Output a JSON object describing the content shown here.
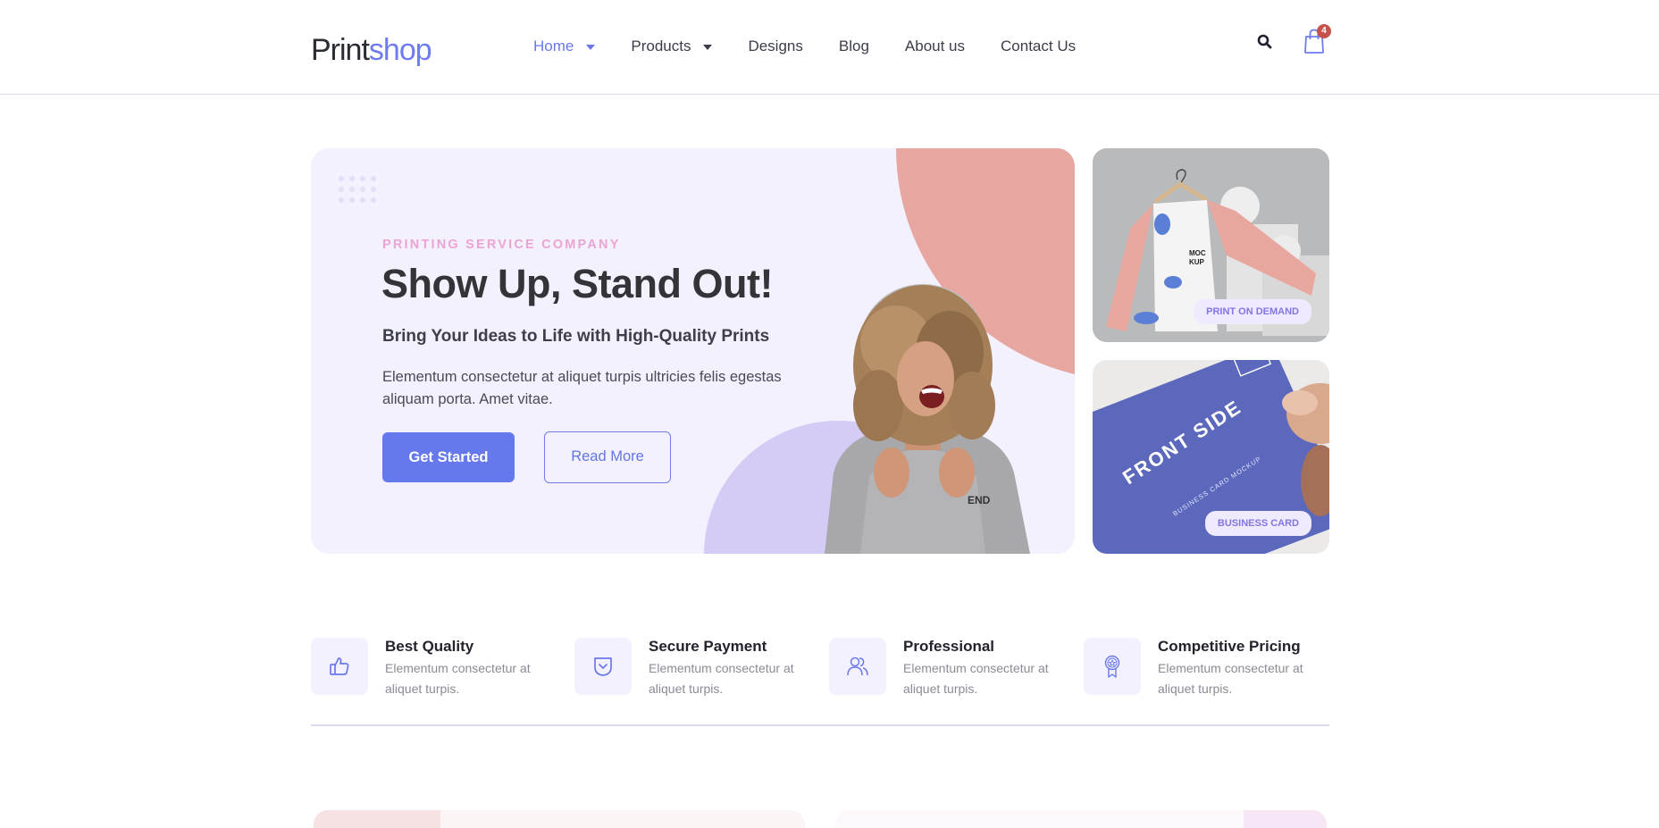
{
  "header": {
    "logo": {
      "part1": "Print",
      "part2": "shop"
    },
    "nav": [
      {
        "label": "Home",
        "has_dropdown": true,
        "active": true
      },
      {
        "label": "Products",
        "has_dropdown": true,
        "active": false
      },
      {
        "label": "Designs",
        "has_dropdown": false,
        "active": false
      },
      {
        "label": "Blog",
        "has_dropdown": false,
        "active": false
      },
      {
        "label": "About us",
        "has_dropdown": false,
        "active": false
      },
      {
        "label": "Contact Us",
        "has_dropdown": false,
        "active": false
      }
    ],
    "search_icon": "search-icon",
    "cart_icon": "shopping-bag-icon",
    "cart_count": "4"
  },
  "hero": {
    "eyebrow": "PRINTING SERVICE COMPANY",
    "title": "Show Up, Stand Out!",
    "subtitle": "Bring Your Ideas to Life with High-Quality Prints",
    "description": "Elementum consectetur at aliquet turpis ultricies felis egestas aliquam porta. Amet vitae.",
    "primary_button": "Get Started",
    "secondary_button": "Read More"
  },
  "side_cards": [
    {
      "tag": "PRINT ON DEMAND",
      "image": "shirt-mockup-image",
      "mock_text": "MOCK UP"
    },
    {
      "tag": "BUSINESS CARD",
      "image": "business-card-image",
      "card_title": "FRONT SIDE",
      "card_sub": "BUSINESS CARD MOCKUP"
    }
  ],
  "features": [
    {
      "title": "Best Quality",
      "description": "Elementum consectetur at aliquet turpis.",
      "icon": "thumbs-up-icon"
    },
    {
      "title": "Secure Payment",
      "description": "Elementum consectetur at aliquet turpis.",
      "icon": "shield-check-icon"
    },
    {
      "title": "Professional",
      "description": "Elementum consectetur at aliquet turpis.",
      "icon": "users-icon"
    },
    {
      "title": "Competitive Pricing",
      "description": "Elementum consectetur at aliquet turpis.",
      "icon": "award-badge-icon"
    }
  ],
  "colors": {
    "accent": "#6578ec",
    "eyebrow": "#eba4d3",
    "hero_bg": "#f3f1fe",
    "blob_pink": "#e8a6a1",
    "blob_purple": "#d4ccf5",
    "badge": "#c4534d"
  }
}
